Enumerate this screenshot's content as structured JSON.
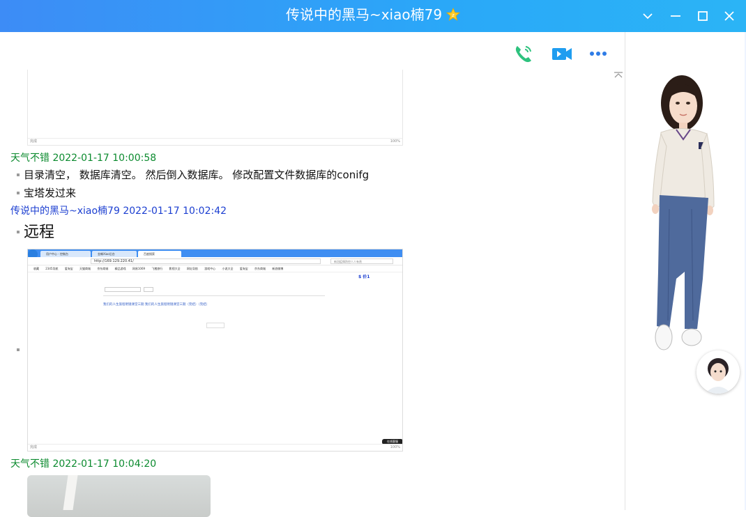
{
  "window": {
    "title": "传说中的黑马~xiao楠79",
    "accent_start": "#3d8cf6",
    "accent_end": "#2bb4f6"
  },
  "toolbar": {
    "icons": [
      "phone-call-icon",
      "video-call-icon",
      "more-icon"
    ]
  },
  "messages": [
    {
      "sender": "天气不错",
      "time": "2022-01-17 10:00:58",
      "color": "#0b8a2e",
      "lines": [
        "目录清空， 数据库清空。 然后倒入数据库。 修改配置文件数据库的conifg",
        "宝塔发过来"
      ]
    },
    {
      "sender": "传说中的黑马~xiao楠79",
      "time": "2022-01-17 10:02:42",
      "color": "#1c3fd1",
      "lines": [
        "远程"
      ]
    },
    {
      "sender": "天气不错",
      "time": "2022-01-17 10:04:20",
      "color": "#0b8a2e",
      "lines": []
    }
  ],
  "sender_lines": [
    "天气不错 2022-01-17 10:00:58",
    "传说中的黑马~xiao楠79 2022-01-17 10:02:42",
    "天气不错 2022-01-17 10:04:20"
  ],
  "screenshot": {
    "tabs": [
      "用户中心 - 控制台",
      "金蛛Xiao后台",
      "百度搜索"
    ],
    "url": "http://169.129.220.41/",
    "search_placeholder": "新冠疫情防控人人有责",
    "bookmarks": [
      "收藏",
      "2345导航",
      "爱淘宝",
      "天猫商城",
      "京东商城",
      "精品游戏",
      "网易1069",
      "飞猪旅行",
      "影视大全",
      "网址导航",
      "游戏中心",
      "小说大全",
      "爱淘宝",
      "京东商城",
      "新浪微博"
    ],
    "page_price": "$ 价1",
    "page_link": "我们的人生旅程明镜课堂三期 我们的人生旅程明镜课堂三期（完结）（完结）",
    "footer_left": "完成",
    "footer_right": "100%",
    "floating_badge": "在线客服"
  }
}
